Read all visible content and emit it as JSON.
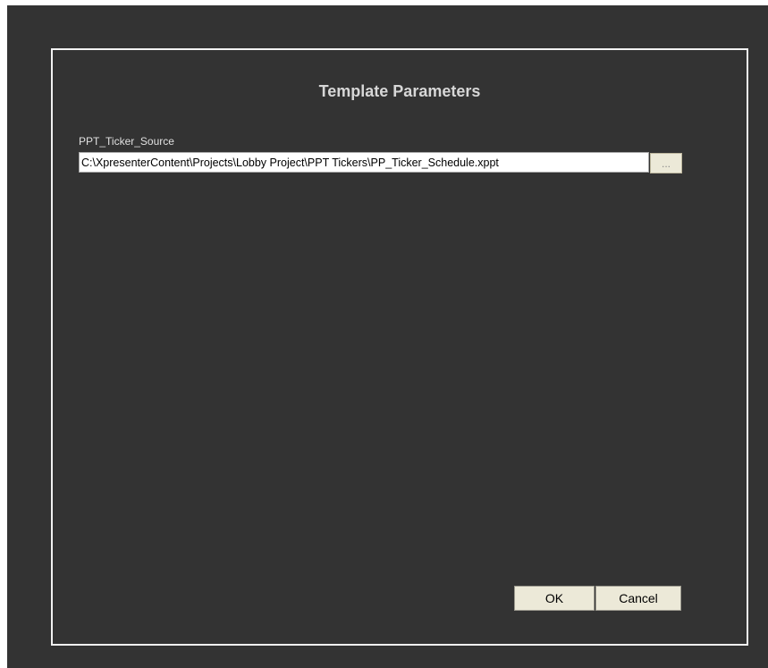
{
  "dialog": {
    "title": "Template Parameters"
  },
  "parameters": [
    {
      "label": "PPT_Ticker_Source",
      "value": "C:\\XpresenterContent\\Projects\\Lobby Project\\PPT Tickers\\PP_Ticker_Schedule.xppt",
      "browse_label": "..."
    }
  ],
  "buttons": {
    "ok_label": "OK",
    "cancel_label": "Cancel"
  },
  "colors": {
    "background": "#333333",
    "panel_border": "#f2f2f2",
    "button_face": "#ece9d8"
  }
}
